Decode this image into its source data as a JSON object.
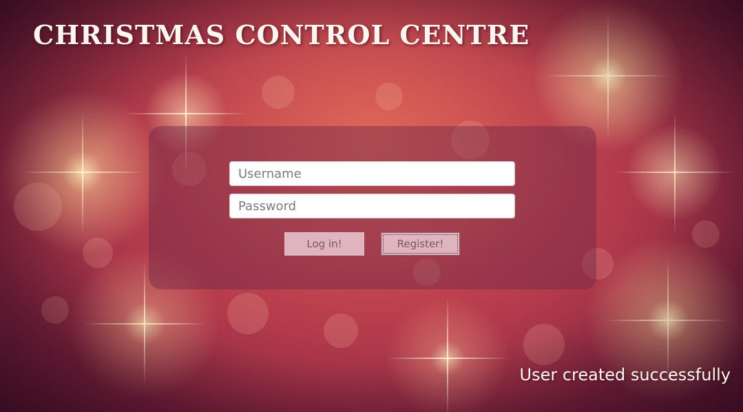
{
  "header": {
    "title": "CHRISTMAS CONTROL CENTRE"
  },
  "login_form": {
    "username_placeholder": "Username",
    "username_value": "",
    "password_placeholder": "Password",
    "password_value": "",
    "login_label": "Log in!",
    "register_label": "Register!"
  },
  "status": {
    "message": "User created successfully"
  },
  "colors": {
    "background_primary": "#a33148",
    "background_glow": "#ffe8b0",
    "panel": "#6e2846",
    "button": "#f0d2dc",
    "title_text": "#fdf6f0"
  }
}
